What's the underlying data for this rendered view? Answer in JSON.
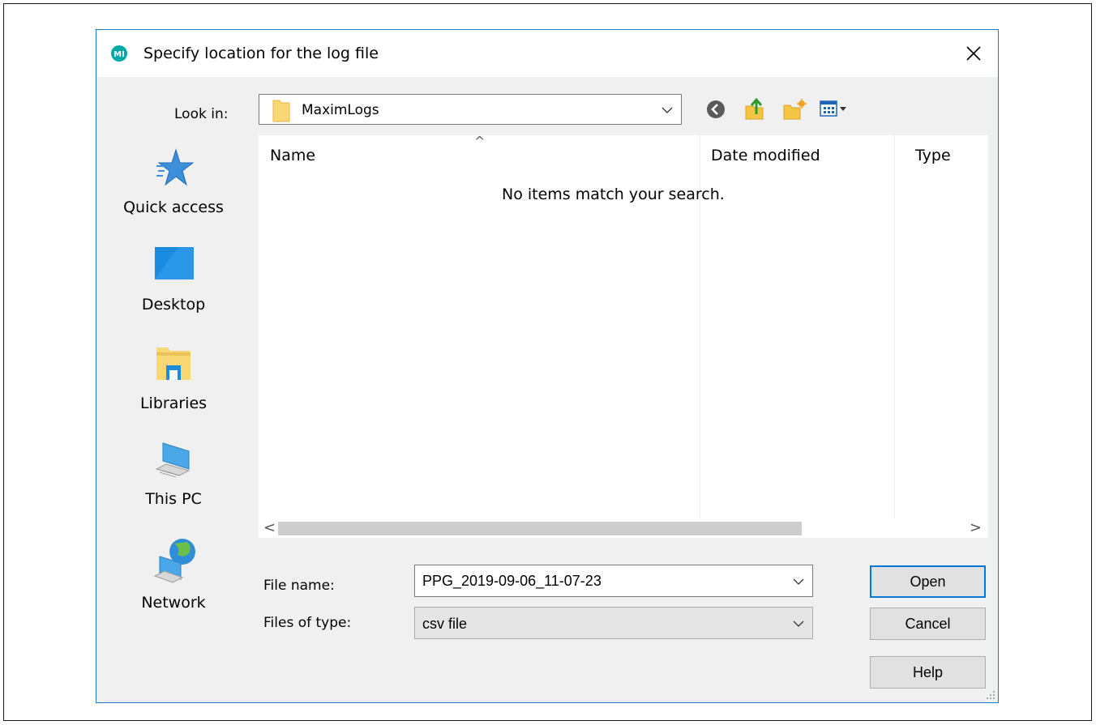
{
  "dialog": {
    "title": "Specify location for the log file",
    "close_glyph": "✕",
    "icon": "maxim-logo-icon"
  },
  "look_in": {
    "label": "Look in:",
    "value": "MaximLogs",
    "folder_icon": "folder-icon"
  },
  "toolbar": {
    "icons": [
      "back-icon",
      "up-folder-icon",
      "new-folder-icon",
      "view-menu-icon"
    ]
  },
  "places": [
    {
      "label": "Quick access",
      "icon": "star-icon"
    },
    {
      "label": "Desktop",
      "icon": "desktop-icon"
    },
    {
      "label": "Libraries",
      "icon": "libraries-icon"
    },
    {
      "label": "This PC",
      "icon": "computer-icon"
    },
    {
      "label": "Network",
      "icon": "network-icon"
    }
  ],
  "file_list": {
    "columns": [
      "Name",
      "Date modified",
      "Type"
    ],
    "sort_glyph": "^",
    "empty_message": "No items match your search.",
    "scroll_left": "<",
    "scroll_right": ">"
  },
  "file_name": {
    "label": "File name:",
    "value": "PPG_2019-09-06_11-07-23"
  },
  "file_type": {
    "label": "Files of type:",
    "value": "csv file"
  },
  "buttons": {
    "open": "Open",
    "cancel": "Cancel",
    "help": "Help"
  },
  "colors": {
    "accent": "#0078d7",
    "dialog_bg": "#f0f0f0",
    "maxim_logo": "#00a9a7"
  }
}
